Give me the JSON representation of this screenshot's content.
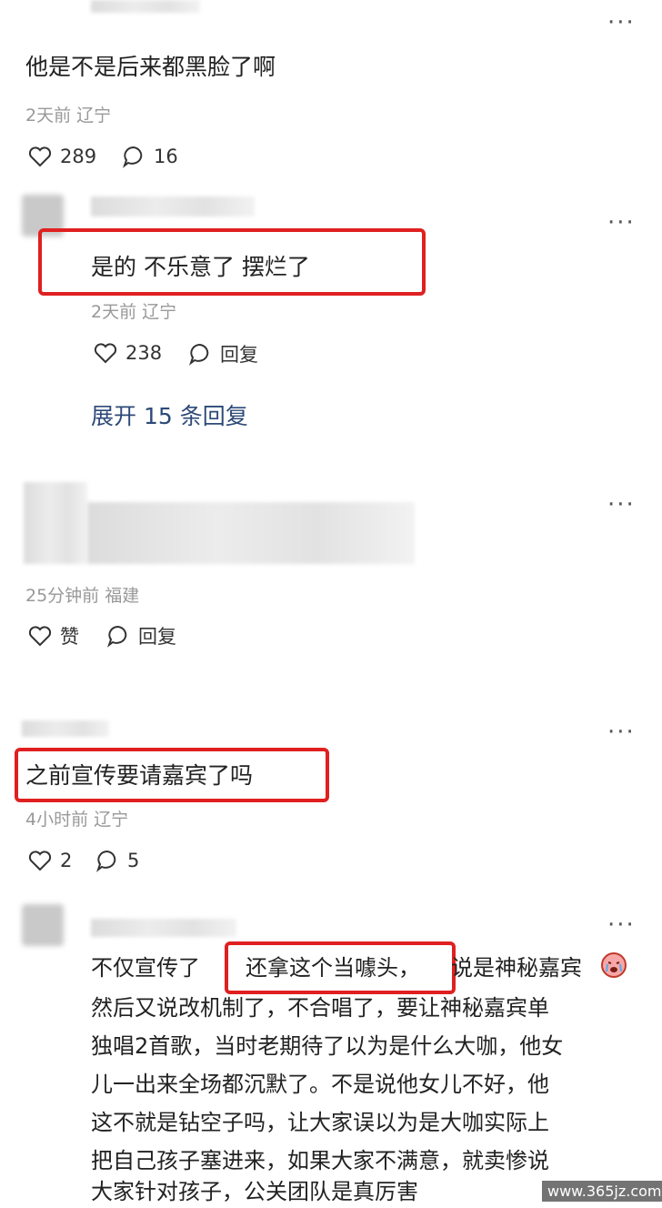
{
  "comments": [
    {
      "text": "他是不是后来都黑脸了啊",
      "meta": "2天前 辽宁",
      "likes": "289",
      "replies": "16"
    },
    {
      "text": "是的 不乐意了 摆烂了",
      "meta": "2天前 辽宁",
      "likes": "238",
      "reply_label": "回复",
      "expand": "展开 15 条回复"
    },
    {
      "meta": "25分钟前 福建",
      "like_label": "赞",
      "reply_label": "回复"
    },
    {
      "text": "之前宣传要请嘉宾了吗",
      "meta": "4小时前 辽宁",
      "likes": "2",
      "replies": "5"
    },
    {
      "line1_a": "不仅宣传了",
      "line1_b": "还拿这个当噱头，",
      "line1_c": "说是神秘嘉宾",
      "lines": [
        "然后又说改机制了，不合唱了，要让神秘嘉宾单",
        "独唱2首歌，当时老期待了以为是什么大咖，他女",
        "儿一出来全场都沉默了。不是说他女儿不好，他",
        "这不就是钻空子吗，让大家误以为是大咖实际上",
        "把自己孩子塞进来，如果大家不满意，就卖惨说",
        "大家针对孩子，公关团队是真厉害"
      ]
    }
  ],
  "more_label": "···",
  "watermark": "www.365jz.com",
  "icons": [
    "heart-icon",
    "comment-bubble-icon",
    "more-options-icon",
    "crying-emoji-icon"
  ],
  "colors": {
    "highlight": "#e02020",
    "link": "#2d4a78",
    "meta": "#999999"
  }
}
